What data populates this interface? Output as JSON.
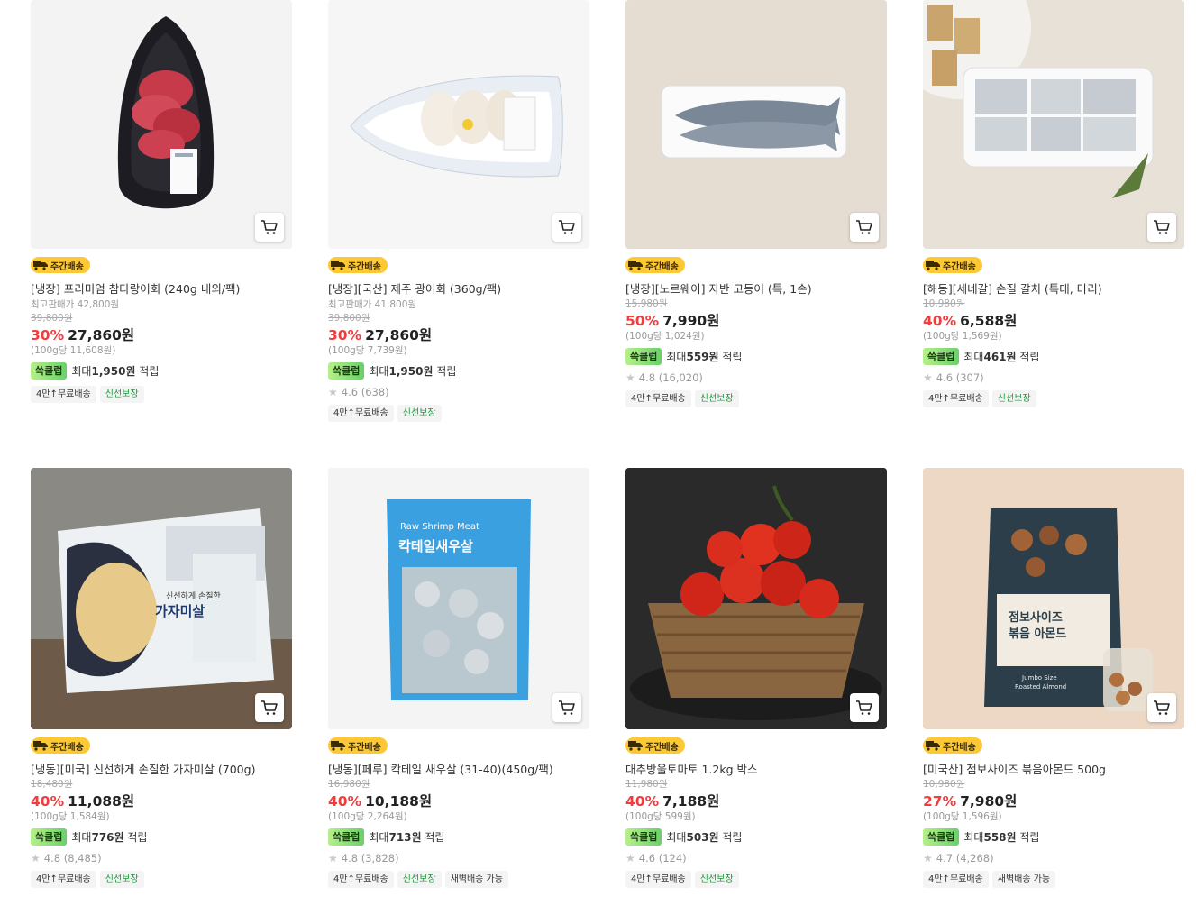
{
  "cards": [
    {
      "badge": "주간배송",
      "name": "[냉장] 프리미엄 참다랑어회 (240g 내외/팩)",
      "best_price": "최고판매가 42,800원",
      "original": "39,800원",
      "discount": "30%",
      "price": "27,860원",
      "unit_price": "(100g당 11,608원)",
      "reward_tag": "쓱클럽",
      "reward_pre": "최대",
      "reward_amount": "1,950원",
      "reward_post": "적립",
      "rating": "",
      "chips": [
        "4만↑무료배송",
        "신선보장"
      ]
    },
    {
      "badge": "주간배송",
      "name": "[냉장][국산] 제주 광어회 (360g/팩)",
      "best_price": "최고판매가 41,800원",
      "original": "39,800원",
      "discount": "30%",
      "price": "27,860원",
      "unit_price": "(100g당 7,739원)",
      "reward_tag": "쓱클럽",
      "reward_pre": "최대",
      "reward_amount": "1,950원",
      "reward_post": "적립",
      "rating": "4.6 (638)",
      "chips": [
        "4만↑무료배송",
        "신선보장"
      ]
    },
    {
      "badge": "주간배송",
      "name": "[냉장][노르웨이] 자반 고등어 (특, 1손)",
      "best_price": "",
      "original": "15,980원",
      "discount": "50%",
      "price": "7,990원",
      "unit_price": "(100g당 1,024원)",
      "reward_tag": "쓱클럽",
      "reward_pre": "최대",
      "reward_amount": "559원",
      "reward_post": "적립",
      "rating": "4.8 (16,020)",
      "chips": [
        "4만↑무료배송",
        "신선보장"
      ]
    },
    {
      "badge": "주간배송",
      "name": "[해동][세네갈] 손질 갈치 (특대, 마리)",
      "best_price": "",
      "original": "10,980원",
      "discount": "40%",
      "price": "6,588원",
      "unit_price": "(100g당 1,569원)",
      "reward_tag": "쓱클럽",
      "reward_pre": "최대",
      "reward_amount": "461원",
      "reward_post": "적립",
      "rating": "4.6 (307)",
      "chips": [
        "4만↑무료배송",
        "신선보장"
      ]
    },
    {
      "badge": "주간배송",
      "name": "[냉동][미국] 신선하게 손질한 가자미살 (700g)",
      "best_price": "",
      "original": "18,480원",
      "discount": "40%",
      "price": "11,088원",
      "unit_price": "(100g당 1,584원)",
      "reward_tag": "쓱클럽",
      "reward_pre": "최대",
      "reward_amount": "776원",
      "reward_post": "적립",
      "rating": "4.8 (8,485)",
      "chips": [
        "4만↑무료배송",
        "신선보장"
      ],
      "package_text": [
        "신선하게 손질한",
        "가자미살"
      ]
    },
    {
      "badge": "주간배송",
      "name": "[냉동][페루] 칵테일 새우살 (31-40)(450g/팩)",
      "best_price": "",
      "original": "16,980원",
      "discount": "40%",
      "price": "10,188원",
      "unit_price": "(100g당 2,264원)",
      "reward_tag": "쓱클럽",
      "reward_pre": "최대",
      "reward_amount": "713원",
      "reward_post": "적립",
      "rating": "4.8 (3,828)",
      "chips": [
        "4만↑무료배송",
        "신선보장",
        "새벽배송 가능"
      ],
      "package_text": [
        "Raw Shrimp Meat",
        "칵테일새우살"
      ]
    },
    {
      "badge": "주간배송",
      "name": "대추방울토마토 1.2kg 박스",
      "best_price": "",
      "original": "11,980원",
      "discount": "40%",
      "price": "7,188원",
      "unit_price": "(100g당 599원)",
      "reward_tag": "쓱클럽",
      "reward_pre": "최대",
      "reward_amount": "503원",
      "reward_post": "적립",
      "rating": "4.6 (124)",
      "chips": [
        "4만↑무료배송",
        "신선보장"
      ]
    },
    {
      "badge": "주간배송",
      "name": "[미국산] 점보사이즈 볶음아몬드 500g",
      "best_price": "",
      "original": "10,980원",
      "discount": "27%",
      "price": "7,980원",
      "unit_price": "(100g당 1,596원)",
      "reward_tag": "쓱클럽",
      "reward_pre": "최대",
      "reward_amount": "558원",
      "reward_post": "적립",
      "rating": "4.7 (4,268)",
      "chips": [
        "4만↑무료배송",
        "새벽배송 가능"
      ],
      "package_text": [
        "점보사이즈",
        "볶음 아몬드",
        "Jumbo Size",
        "Roasted Almond"
      ]
    }
  ],
  "colors": {
    "discount": "#f03e3e",
    "badge_bg": "#fcc834",
    "reward_green": "#6ad06a",
    "chip_green": "#1a9a3a"
  },
  "icons": {
    "cart": "cart-icon",
    "truck": "truck-icon",
    "star": "star-icon"
  }
}
